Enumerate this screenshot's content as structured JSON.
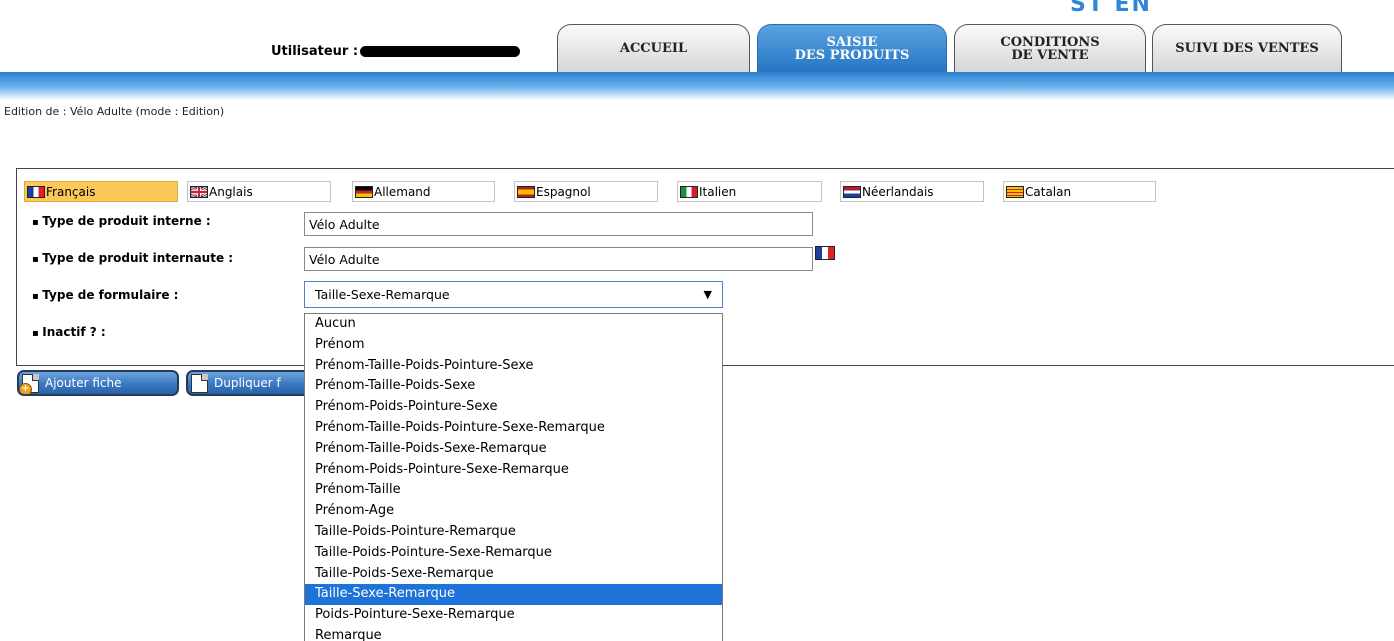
{
  "header": {
    "logo_fragment": "ST EN  ",
    "user_label": "Utilisateur :",
    "tabs": [
      {
        "label": "ACCUEIL"
      },
      {
        "label": "SAISIE\nDES PRODUITS"
      },
      {
        "label": "CONDITIONS\nDE VENTE"
      },
      {
        "label": "SUIVI DES VENTES"
      }
    ]
  },
  "breadcrumb": "Edition de : Vélo Adulte (mode : Edition)",
  "languages": [
    {
      "label": "Français",
      "flag": "fr-flag-icon"
    },
    {
      "label": "Anglais",
      "flag": "uk-flag-icon"
    },
    {
      "label": "Allemand",
      "flag": "de-flag-icon"
    },
    {
      "label": "Espagnol",
      "flag": "es-flag-icon"
    },
    {
      "label": "Italien",
      "flag": "it-flag-icon"
    },
    {
      "label": "Néerlandais",
      "flag": "nl-flag-icon"
    },
    {
      "label": "Catalan",
      "flag": "catalan-flag-icon"
    }
  ],
  "form": {
    "type_interne_label": "Type de produit interne :",
    "type_interne_value": "Vélo Adulte",
    "type_internaute_label": "Type de produit internaute :",
    "type_internaute_value": "Vélo Adulte",
    "type_formulaire_label": "Type de formulaire :",
    "type_formulaire_value": "Taille-Sexe-Remarque",
    "inactif_label": "Inactif ? :",
    "formulaire_options": [
      "Aucun",
      "Prénom",
      "Prénom-Taille-Poids-Pointure-Sexe",
      "Prénom-Taille-Poids-Sexe",
      "Prénom-Poids-Pointure-Sexe",
      "Prénom-Taille-Poids-Pointure-Sexe-Remarque",
      "Prénom-Taille-Poids-Sexe-Remarque",
      "Prénom-Poids-Pointure-Sexe-Remarque",
      "Prénom-Taille",
      "Prénom-Age",
      "Taille-Poids-Pointure-Remarque",
      "Taille-Poids-Pointure-Sexe-Remarque",
      "Taille-Poids-Sexe-Remarque",
      "Taille-Sexe-Remarque",
      "Poids-Pointure-Sexe-Remarque",
      "Remarque"
    ]
  },
  "buttons": {
    "ajouter": "Ajouter fiche",
    "dupliquer": "Dupliquer f"
  },
  "colors": {
    "accent_blue": "#2676c4",
    "selected_option": "#1e73d9",
    "active_language": "#fbc95a"
  }
}
